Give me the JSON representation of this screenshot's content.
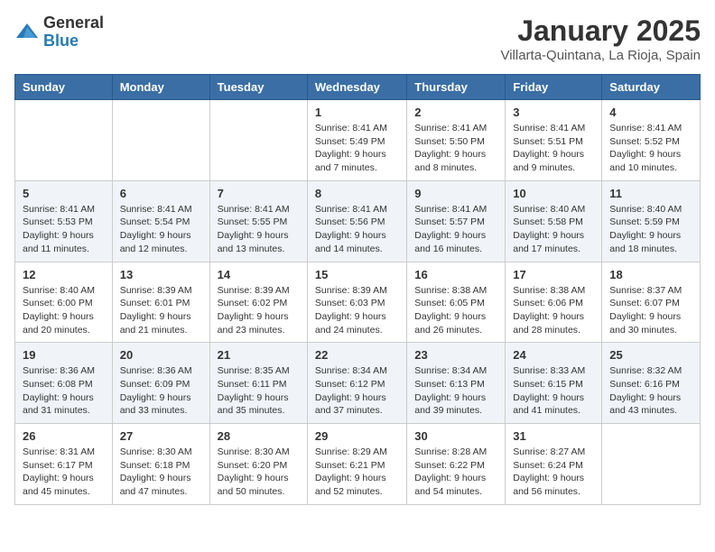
{
  "logo": {
    "general": "General",
    "blue": "Blue"
  },
  "title": "January 2025",
  "location": "Villarta-Quintana, La Rioja, Spain",
  "weekdays": [
    "Sunday",
    "Monday",
    "Tuesday",
    "Wednesday",
    "Thursday",
    "Friday",
    "Saturday"
  ],
  "weeks": [
    [
      {
        "day": "",
        "info": ""
      },
      {
        "day": "",
        "info": ""
      },
      {
        "day": "",
        "info": ""
      },
      {
        "day": "1",
        "info": "Sunrise: 8:41 AM\nSunset: 5:49 PM\nDaylight: 9 hours and 7 minutes."
      },
      {
        "day": "2",
        "info": "Sunrise: 8:41 AM\nSunset: 5:50 PM\nDaylight: 9 hours and 8 minutes."
      },
      {
        "day": "3",
        "info": "Sunrise: 8:41 AM\nSunset: 5:51 PM\nDaylight: 9 hours and 9 minutes."
      },
      {
        "day": "4",
        "info": "Sunrise: 8:41 AM\nSunset: 5:52 PM\nDaylight: 9 hours and 10 minutes."
      }
    ],
    [
      {
        "day": "5",
        "info": "Sunrise: 8:41 AM\nSunset: 5:53 PM\nDaylight: 9 hours and 11 minutes."
      },
      {
        "day": "6",
        "info": "Sunrise: 8:41 AM\nSunset: 5:54 PM\nDaylight: 9 hours and 12 minutes."
      },
      {
        "day": "7",
        "info": "Sunrise: 8:41 AM\nSunset: 5:55 PM\nDaylight: 9 hours and 13 minutes."
      },
      {
        "day": "8",
        "info": "Sunrise: 8:41 AM\nSunset: 5:56 PM\nDaylight: 9 hours and 14 minutes."
      },
      {
        "day": "9",
        "info": "Sunrise: 8:41 AM\nSunset: 5:57 PM\nDaylight: 9 hours and 16 minutes."
      },
      {
        "day": "10",
        "info": "Sunrise: 8:40 AM\nSunset: 5:58 PM\nDaylight: 9 hours and 17 minutes."
      },
      {
        "day": "11",
        "info": "Sunrise: 8:40 AM\nSunset: 5:59 PM\nDaylight: 9 hours and 18 minutes."
      }
    ],
    [
      {
        "day": "12",
        "info": "Sunrise: 8:40 AM\nSunset: 6:00 PM\nDaylight: 9 hours and 20 minutes."
      },
      {
        "day": "13",
        "info": "Sunrise: 8:39 AM\nSunset: 6:01 PM\nDaylight: 9 hours and 21 minutes."
      },
      {
        "day": "14",
        "info": "Sunrise: 8:39 AM\nSunset: 6:02 PM\nDaylight: 9 hours and 23 minutes."
      },
      {
        "day": "15",
        "info": "Sunrise: 8:39 AM\nSunset: 6:03 PM\nDaylight: 9 hours and 24 minutes."
      },
      {
        "day": "16",
        "info": "Sunrise: 8:38 AM\nSunset: 6:05 PM\nDaylight: 9 hours and 26 minutes."
      },
      {
        "day": "17",
        "info": "Sunrise: 8:38 AM\nSunset: 6:06 PM\nDaylight: 9 hours and 28 minutes."
      },
      {
        "day": "18",
        "info": "Sunrise: 8:37 AM\nSunset: 6:07 PM\nDaylight: 9 hours and 30 minutes."
      }
    ],
    [
      {
        "day": "19",
        "info": "Sunrise: 8:36 AM\nSunset: 6:08 PM\nDaylight: 9 hours and 31 minutes."
      },
      {
        "day": "20",
        "info": "Sunrise: 8:36 AM\nSunset: 6:09 PM\nDaylight: 9 hours and 33 minutes."
      },
      {
        "day": "21",
        "info": "Sunrise: 8:35 AM\nSunset: 6:11 PM\nDaylight: 9 hours and 35 minutes."
      },
      {
        "day": "22",
        "info": "Sunrise: 8:34 AM\nSunset: 6:12 PM\nDaylight: 9 hours and 37 minutes."
      },
      {
        "day": "23",
        "info": "Sunrise: 8:34 AM\nSunset: 6:13 PM\nDaylight: 9 hours and 39 minutes."
      },
      {
        "day": "24",
        "info": "Sunrise: 8:33 AM\nSunset: 6:15 PM\nDaylight: 9 hours and 41 minutes."
      },
      {
        "day": "25",
        "info": "Sunrise: 8:32 AM\nSunset: 6:16 PM\nDaylight: 9 hours and 43 minutes."
      }
    ],
    [
      {
        "day": "26",
        "info": "Sunrise: 8:31 AM\nSunset: 6:17 PM\nDaylight: 9 hours and 45 minutes."
      },
      {
        "day": "27",
        "info": "Sunrise: 8:30 AM\nSunset: 6:18 PM\nDaylight: 9 hours and 47 minutes."
      },
      {
        "day": "28",
        "info": "Sunrise: 8:30 AM\nSunset: 6:20 PM\nDaylight: 9 hours and 50 minutes."
      },
      {
        "day": "29",
        "info": "Sunrise: 8:29 AM\nSunset: 6:21 PM\nDaylight: 9 hours and 52 minutes."
      },
      {
        "day": "30",
        "info": "Sunrise: 8:28 AM\nSunset: 6:22 PM\nDaylight: 9 hours and 54 minutes."
      },
      {
        "day": "31",
        "info": "Sunrise: 8:27 AM\nSunset: 6:24 PM\nDaylight: 9 hours and 56 minutes."
      },
      {
        "day": "",
        "info": ""
      }
    ]
  ]
}
